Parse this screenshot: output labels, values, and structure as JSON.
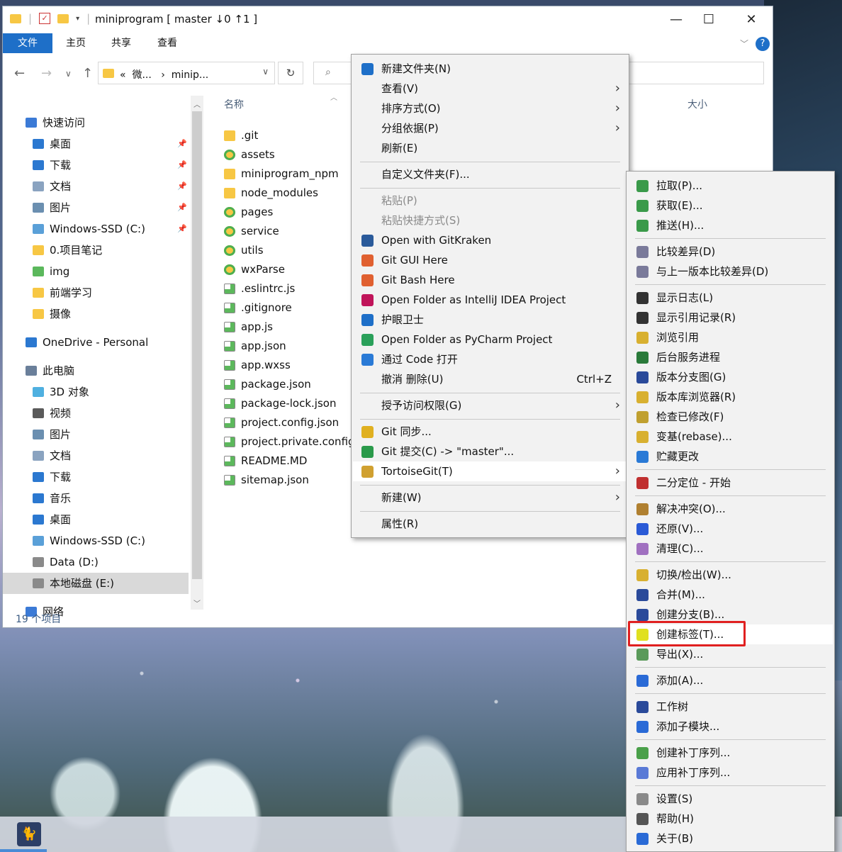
{
  "window": {
    "title": "miniprogram [ master ↓0 ↑1 ]",
    "ribbon_tabs": [
      "文件",
      "主页",
      "共享",
      "查看"
    ],
    "address": {
      "crumb1": "微...",
      "crumb2": "minip...",
      "prefix": "«"
    },
    "status": "19 个项目"
  },
  "nav": {
    "items": [
      {
        "label": "快速访问",
        "pinned": false
      },
      {
        "label": "桌面",
        "pinned": true
      },
      {
        "label": "下载",
        "pinned": true
      },
      {
        "label": "文档",
        "pinned": true
      },
      {
        "label": "图片",
        "pinned": true
      },
      {
        "label": "Windows-SSD (C:)",
        "pinned": true
      },
      {
        "label": "0.项目笔记",
        "pinned": false
      },
      {
        "label": "img",
        "pinned": false
      },
      {
        "label": "前端学习",
        "pinned": false
      },
      {
        "label": "摄像",
        "pinned": false
      },
      {
        "label": "OneDrive - Personal",
        "pinned": false
      },
      {
        "label": "此电脑",
        "pinned": false
      },
      {
        "label": "3D 对象",
        "pinned": false
      },
      {
        "label": "视频",
        "pinned": false
      },
      {
        "label": "图片",
        "pinned": false
      },
      {
        "label": "文档",
        "pinned": false
      },
      {
        "label": "下载",
        "pinned": false
      },
      {
        "label": "音乐",
        "pinned": false
      },
      {
        "label": "桌面",
        "pinned": false
      },
      {
        "label": "Windows-SSD (C:)",
        "pinned": false
      },
      {
        "label": "Data (D:)",
        "pinned": false
      },
      {
        "label": "本地磁盘 (E:)",
        "pinned": false
      },
      {
        "label": "网络",
        "pinned": false
      }
    ]
  },
  "files": {
    "columns": {
      "name": "名称",
      "size": "大小"
    },
    "items": [
      ".git",
      "assets",
      "miniprogram_npm",
      "node_modules",
      "pages",
      "service",
      "utils",
      "wxParse",
      ".eslintrc.js",
      ".gitignore",
      "app.js",
      "app.json",
      "app.wxss",
      "package.json",
      "package-lock.json",
      "project.config.json",
      "project.private.config",
      "README.MD",
      "sitemap.json"
    ]
  },
  "context_menu": {
    "items": [
      {
        "label": "新建文件夹(N)",
        "icon": "new-folder-icon"
      },
      {
        "label": "查看(V)",
        "submenu": true
      },
      {
        "label": "排序方式(O)",
        "submenu": true
      },
      {
        "label": "分组依据(P)",
        "submenu": true
      },
      {
        "label": "刷新(E)"
      },
      {
        "label": "自定义文件夹(F)..."
      },
      {
        "label": "粘贴(P)",
        "disabled": true
      },
      {
        "label": "粘贴快捷方式(S)",
        "disabled": true
      },
      {
        "label": "Open with GitKraken",
        "icon": "gitkraken-icon"
      },
      {
        "label": "Git GUI Here",
        "icon": "git-icon"
      },
      {
        "label": "Git Bash Here",
        "icon": "git-icon"
      },
      {
        "label": "Open Folder as IntelliJ IDEA Project",
        "icon": "intellij-icon"
      },
      {
        "label": "护眼卫士",
        "icon": "eye-guard-icon"
      },
      {
        "label": "Open Folder as PyCharm Project",
        "icon": "pycharm-icon"
      },
      {
        "label": "通过 Code 打开",
        "icon": "vscode-icon"
      },
      {
        "label": "撤消 删除(U)",
        "shortcut": "Ctrl+Z"
      },
      {
        "label": "授予访问权限(G)",
        "submenu": true
      },
      {
        "label": "Git 同步...",
        "icon": "git-sync-icon"
      },
      {
        "label": "Git 提交(C) -> \"master\"...",
        "icon": "git-commit-icon"
      },
      {
        "label": "TortoiseGit(T)",
        "submenu": true,
        "icon": "tortoisegit-icon"
      },
      {
        "label": "新建(W)",
        "submenu": true
      },
      {
        "label": "属性(R)"
      }
    ]
  },
  "tortoise_menu": {
    "items": [
      {
        "label": "拉取(P)...",
        "icon": "pull-icon"
      },
      {
        "label": "获取(E)...",
        "icon": "fetch-icon"
      },
      {
        "label": "推送(H)...",
        "icon": "push-icon"
      },
      {
        "label": "比较差异(D)",
        "icon": "diff-icon"
      },
      {
        "label": "与上一版本比较差异(D)",
        "icon": "diff-prev-icon"
      },
      {
        "label": "显示日志(L)",
        "icon": "log-icon"
      },
      {
        "label": "显示引用记录(R)",
        "icon": "reflog-icon"
      },
      {
        "label": "浏览引用",
        "icon": "browse-refs-icon"
      },
      {
        "label": "后台服务进程",
        "icon": "daemon-icon"
      },
      {
        "label": "版本分支图(G)",
        "icon": "revgraph-icon"
      },
      {
        "label": "版本库浏览器(R)",
        "icon": "repo-browser-icon"
      },
      {
        "label": "检查已修改(F)",
        "icon": "check-modifications-icon"
      },
      {
        "label": "变基(rebase)...",
        "icon": "rebase-icon"
      },
      {
        "label": "贮藏更改",
        "icon": "stash-icon"
      },
      {
        "label": "二分定位 - 开始",
        "icon": "bisect-icon"
      },
      {
        "label": "解决冲突(O)...",
        "icon": "resolve-icon"
      },
      {
        "label": "还原(V)...",
        "icon": "revert-icon"
      },
      {
        "label": "清理(C)...",
        "icon": "cleanup-icon"
      },
      {
        "label": "切换/检出(W)...",
        "icon": "switch-icon"
      },
      {
        "label": "合并(M)...",
        "icon": "merge-icon"
      },
      {
        "label": "创建分支(B)...",
        "icon": "branch-icon"
      },
      {
        "label": "创建标签(T)...",
        "icon": "tag-icon",
        "highlighted": true
      },
      {
        "label": "导出(X)...",
        "icon": "export-icon"
      },
      {
        "label": "添加(A)...",
        "icon": "add-icon"
      },
      {
        "label": "工作树",
        "icon": "worktree-icon"
      },
      {
        "label": "添加子模块...",
        "icon": "submodule-icon"
      },
      {
        "label": "创建补丁序列...",
        "icon": "create-patch-icon"
      },
      {
        "label": "应用补丁序列...",
        "icon": "apply-patch-icon"
      },
      {
        "label": "设置(S)",
        "icon": "settings-icon"
      },
      {
        "label": "帮助(H)",
        "icon": "help-icon"
      },
      {
        "label": "关于(B)",
        "icon": "about-icon"
      }
    ]
  }
}
